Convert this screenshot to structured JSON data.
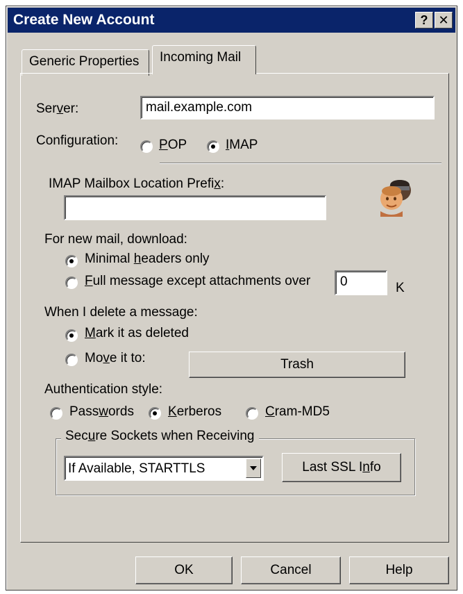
{
  "window": {
    "title": "Create New Account",
    "help_button": "?",
    "close_button": "✕"
  },
  "tabs": [
    {
      "label": "Generic Properties",
      "active": false
    },
    {
      "label": "Incoming Mail",
      "active": true
    }
  ],
  "server": {
    "label_pre": "Ser",
    "label_mnemonic": "v",
    "label_post": "er:",
    "value": "mail.example.com"
  },
  "configuration": {
    "label": "Configuration:",
    "pop_mnemonic": "P",
    "pop_rest": "OP",
    "imap_mnemonic": "I",
    "imap_rest": "MAP",
    "selected": "IMAP"
  },
  "imap_prefix": {
    "label_pre": "IMAP Mailbox Location Prefi",
    "label_mnemonic": "x",
    "label_post": ":",
    "value": ""
  },
  "download": {
    "label": "For new mail, download:",
    "opt1_pre": "Minimal ",
    "opt1_mnemonic": "h",
    "opt1_post": "eaders only",
    "opt2_mnemonic": "F",
    "opt2_post": "ull message except attachments over",
    "size_value": "0",
    "size_unit": "K",
    "selected": "minimal"
  },
  "delete": {
    "label": "When I delete a message:",
    "opt1_mnemonic": "M",
    "opt1_post": "ark it as deleted",
    "opt2_pre": "Mo",
    "opt2_mnemonic": "v",
    "opt2_post": "e it to:",
    "folder_button": "Trash",
    "selected": "mark"
  },
  "auth": {
    "label": "Authentication style:",
    "opt1_pre": "Pass",
    "opt1_mnemonic": "w",
    "opt1_post": "ords",
    "opt2_mnemonic": "K",
    "opt2_post": "erberos",
    "opt3_mnemonic": "C",
    "opt3_post": "ram-MD5",
    "selected": "kerberos"
  },
  "ssl": {
    "group_label_pre": "Sec",
    "group_label_mnemonic": "u",
    "group_label_post": "re Sockets when Receiving",
    "selected_option": "If Available, STARTTLS",
    "info_button_pre": "Last SSL I",
    "info_button_mnemonic": "n",
    "info_button_post": "fo"
  },
  "footer": {
    "ok": "OK",
    "cancel": "Cancel",
    "help": "Help"
  },
  "colors": {
    "titlebar": "#0a246a",
    "face": "#d4d0c8"
  }
}
